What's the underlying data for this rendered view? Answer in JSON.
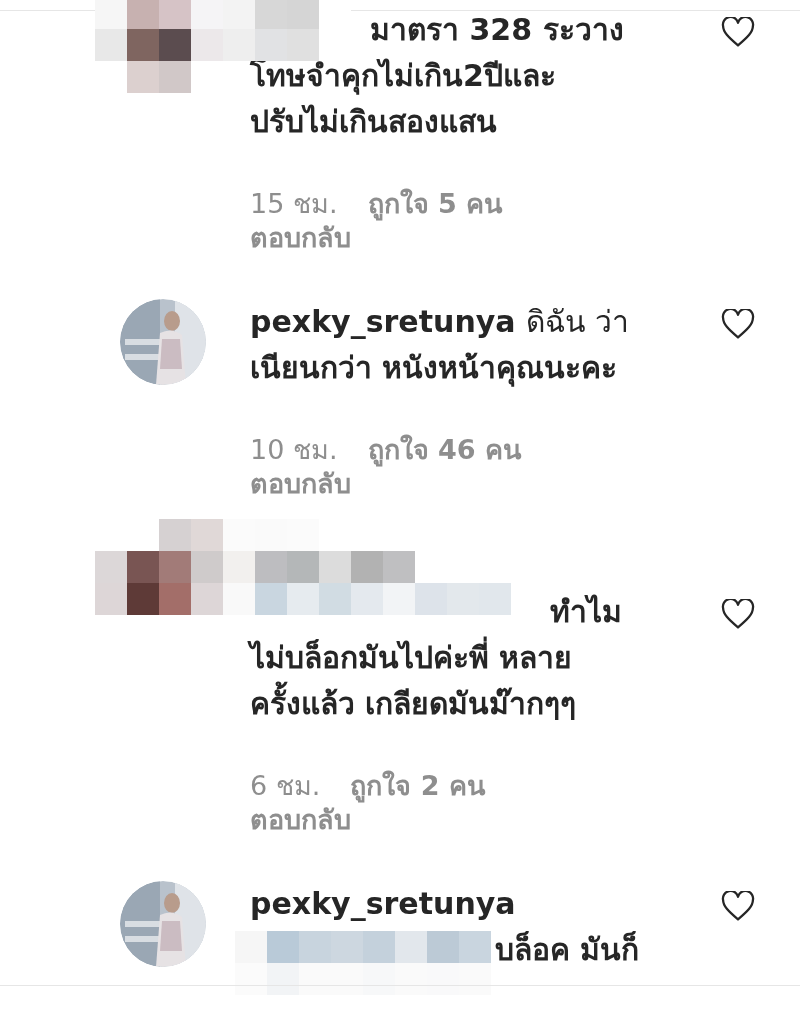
{
  "comments": [
    {
      "lines": [
        "มาตรา 328 ระวาง",
        "โทษจำคุกไม่เกิน2ปีและ",
        "ปรับไม่เกินสองแสน"
      ],
      "time": "15 ชม.",
      "likes": "ถูกใจ 5 คน",
      "reply": "ตอบกลับ"
    },
    {
      "username": "pexky_sretunya",
      "lines": [
        "ดิฉัน ว่า",
        "เนียนกว่า หนังหน้าคุณนะคะ"
      ],
      "time": "10 ชม.",
      "likes": "ถูกใจ 46 คน",
      "reply": "ตอบกลับ"
    },
    {
      "lines": [
        "ทำไม",
        "ไม่บล็อกมันไปค่ะพี่ หลาย",
        "ครั้งแล้ว เกลียดมันม๊ากๆๆ"
      ],
      "time": "6 ชม.",
      "likes": "ถูกใจ 2 คน",
      "reply": "ตอบกลับ"
    },
    {
      "username": "pexky_sretunya",
      "lines": [
        "บล็อค มันก็"
      ]
    }
  ]
}
